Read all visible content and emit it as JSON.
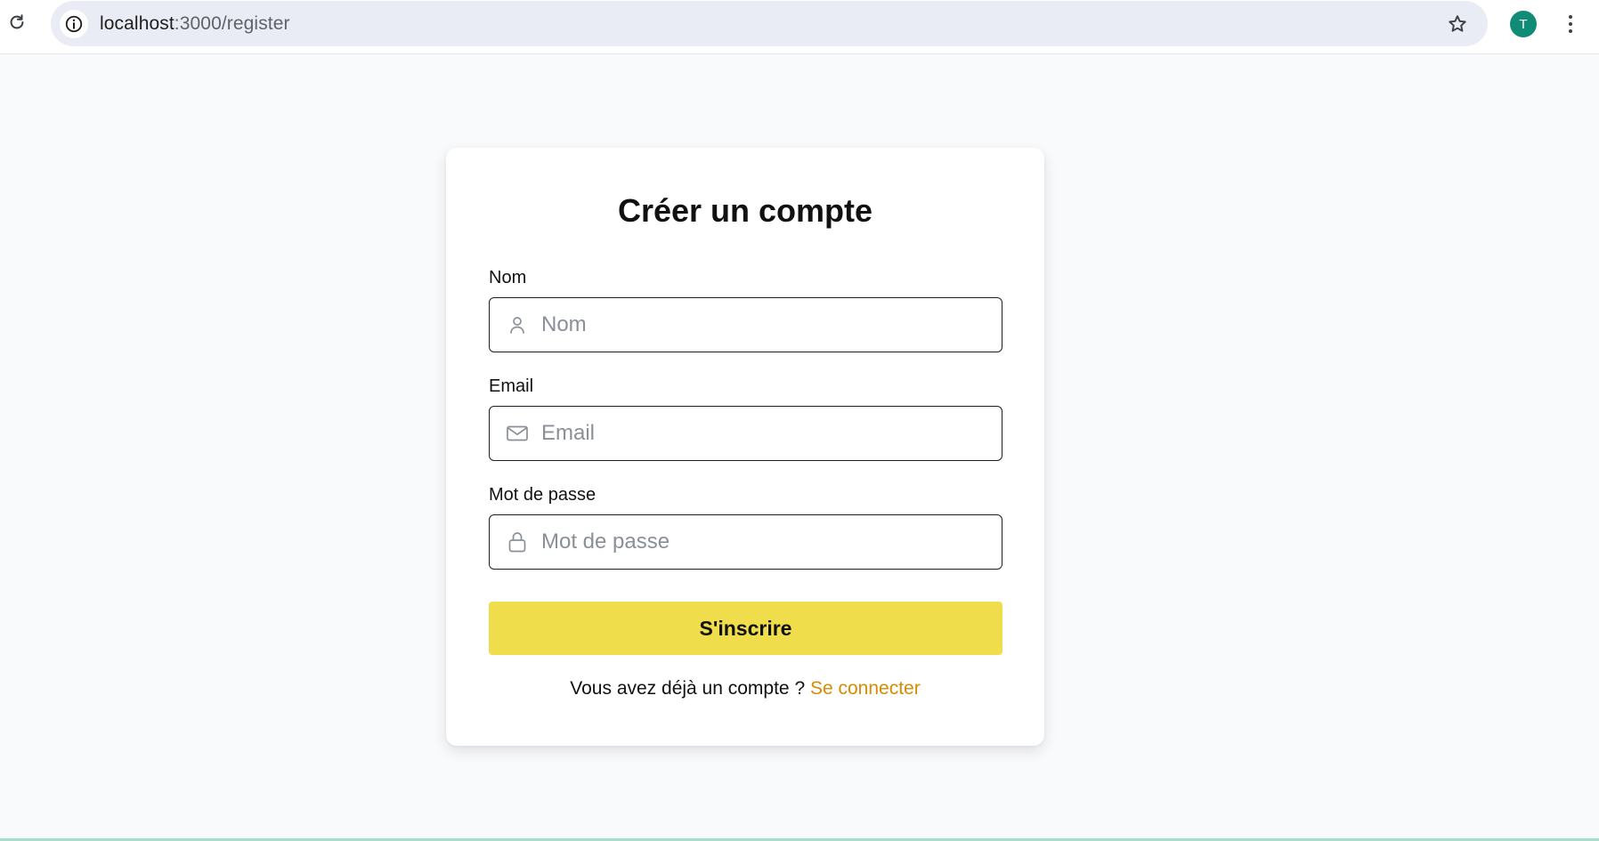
{
  "browser": {
    "url_host": "localhost",
    "url_path": ":3000/register",
    "avatar_initial": "T"
  },
  "register": {
    "title": "Créer un compte",
    "name_label": "Nom",
    "name_placeholder": "Nom",
    "name_value": "",
    "email_label": "Email",
    "email_placeholder": "Email",
    "email_value": "",
    "password_label": "Mot de passe",
    "password_placeholder": "Mot de passe",
    "password_value": "",
    "submit_label": "S'inscrire",
    "login_prompt": "Vous avez déjà un compte ?",
    "login_link": "Se connecter"
  },
  "icons": {
    "reload": "reload-icon",
    "site_info": "info-icon",
    "bookmark": "star-icon",
    "menu": "kebab-menu-icon",
    "name_field": "user-icon",
    "email_field": "mail-icon",
    "password_field": "lock-icon"
  },
  "colors": {
    "page_bg": "#f9fafb",
    "card_bg": "#ffffff",
    "button": "#efdd4b",
    "link": "#d68b00",
    "avatar": "#0f8b76"
  }
}
